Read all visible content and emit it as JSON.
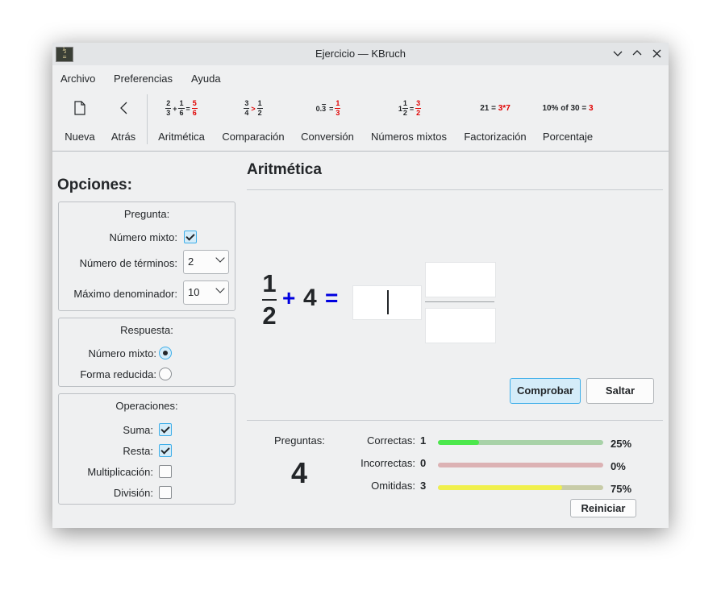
{
  "window": {
    "title": "Ejercicio — KBruch"
  },
  "menu": [
    "Archivo",
    "Preferencias",
    "Ayuda"
  ],
  "toolbar": {
    "nueva": "Nueva",
    "atras": "Atrás",
    "modes": [
      {
        "label": "Aritmética"
      },
      {
        "label": "Comparación"
      },
      {
        "label": "Conversión"
      },
      {
        "label": "Números mixtos"
      },
      {
        "label": "Factorización"
      },
      {
        "label": "Porcentaje"
      }
    ],
    "icons": {
      "aritmetica": {
        "a_n": "2",
        "a_d": "3",
        "op": "+",
        "b_n": "1",
        "b_d": "6",
        "eq": "=",
        "r_n": "5",
        "r_d": "6"
      },
      "comparacion": {
        "a_n": "3",
        "a_d": "4",
        "op": ">",
        "b_n": "1",
        "b_d": "2"
      },
      "conversion": {
        "dec": "0.3",
        "eq": "=",
        "r_n": "1",
        "r_d": "3"
      },
      "mixtos": {
        "whole": "1",
        "a_n": "1",
        "a_d": "2",
        "eq": "=",
        "r_n": "3",
        "r_d": "2"
      },
      "factorizacion": {
        "lhs": "21 =",
        "rhs": "3*7"
      },
      "porcentaje": {
        "lhs": "10% of 30 =",
        "rhs": "3"
      }
    }
  },
  "options": {
    "title": "Opciones:",
    "pregunta": {
      "title": "Pregunta:",
      "mixto_label": "Número mixto:",
      "mixto_checked": true,
      "terminos_label": "Número de términos:",
      "terminos_value": "2",
      "denominador_label": "Máximo denominador:",
      "denominador_value": "10"
    },
    "respuesta": {
      "title": "Respuesta:",
      "mixto_label": "Número mixto:",
      "reducida_label": "Forma reducida:",
      "selected": "mixto"
    },
    "operaciones": {
      "title": "Operaciones:",
      "items": [
        {
          "label": "Suma:",
          "checked": true
        },
        {
          "label": "Resta:",
          "checked": true
        },
        {
          "label": "Multiplicación:",
          "checked": false
        },
        {
          "label": "División:",
          "checked": false
        }
      ]
    }
  },
  "task": {
    "title": "Aritmética",
    "numerator": "1",
    "denominator": "2",
    "operator": "+",
    "whole": "4",
    "equals": "=",
    "check_button": "Comprobar",
    "skip_button": "Saltar"
  },
  "stats": {
    "questions_label": "Preguntas:",
    "questions_count": "4",
    "rows": [
      {
        "label": "Correctas:",
        "count": "1",
        "percent": "25%",
        "fraction": 0.25,
        "fill_color": "#4ce84c",
        "track_color": "#a8d2a8"
      },
      {
        "label": "Incorrectas:",
        "count": "0",
        "percent": "0%",
        "fraction": 0,
        "fill_color": "#e8a0a0",
        "track_color": "#dcb2b4"
      },
      {
        "label": "Omitidas:",
        "count": "3",
        "percent": "75%",
        "fraction": 0.75,
        "fill_color": "#f0f04c",
        "track_color": "#c8cca8"
      }
    ],
    "reset_button": "Reiniciar"
  }
}
